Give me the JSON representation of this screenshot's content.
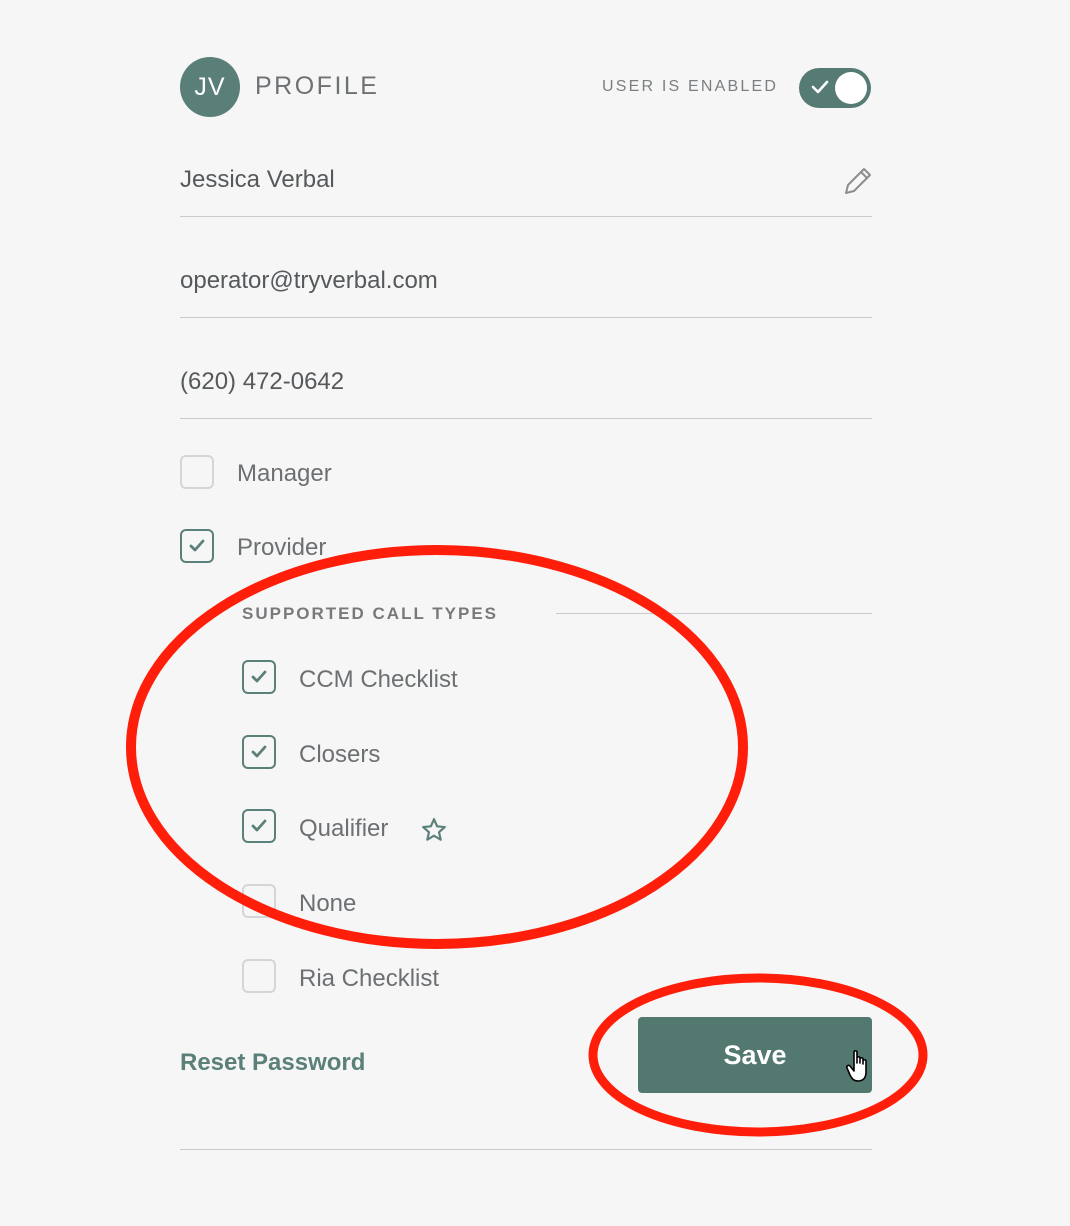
{
  "header": {
    "avatar_initials": "JV",
    "title": "PROFILE",
    "enabled_label": "USER IS ENABLED",
    "enabled": true
  },
  "fields": {
    "name": "Jessica Verbal",
    "email": "operator@tryverbal.com",
    "phone": "(620) 472-0642"
  },
  "roles": [
    {
      "label": "Manager",
      "checked": false
    },
    {
      "label": "Provider",
      "checked": true
    }
  ],
  "call_types": {
    "heading": "SUPPORTED CALL TYPES",
    "items": [
      {
        "label": "CCM Checklist",
        "checked": true
      },
      {
        "label": "Closers",
        "checked": true
      },
      {
        "label": "Qualifier",
        "checked": true,
        "icon": "star-icon"
      },
      {
        "label": "None",
        "checked": false
      },
      {
        "label": "Ria Checklist",
        "checked": false
      }
    ]
  },
  "actions": {
    "reset_password": "Reset Password",
    "save": "Save"
  },
  "colors": {
    "accent": "#5a7f78",
    "annotation": "#ff1e0a"
  }
}
